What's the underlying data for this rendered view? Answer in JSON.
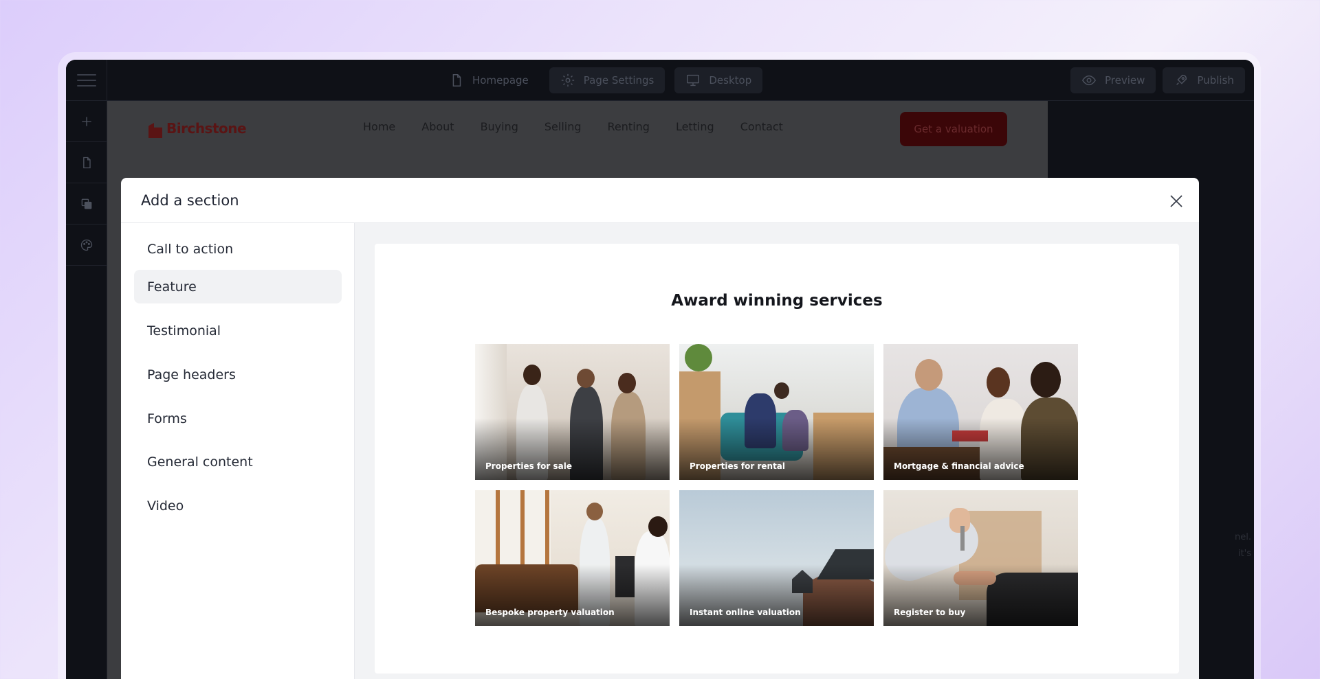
{
  "topbar": {
    "page_label": "Homepage",
    "settings_label": "Page Settings",
    "device_label": "Desktop",
    "preview_label": "Preview",
    "publish_label": "Publish"
  },
  "site": {
    "logo_text": "Birchstone",
    "nav": [
      "Home",
      "About",
      "Buying",
      "Selling",
      "Renting",
      "Letting",
      "Contact"
    ],
    "cta_label": "Get a valuation"
  },
  "right_panel": {
    "hint_lines": [
      "nel.",
      "it's"
    ]
  },
  "modal": {
    "title": "Add a section",
    "categories": [
      "Call to action",
      "Feature",
      "Testimonial",
      "Page headers",
      "Forms",
      "General content",
      "Video"
    ],
    "active_category": "Feature",
    "preview": {
      "heading": "Award winning services",
      "tiles": [
        "Properties for sale",
        "Properties for rental",
        "Mortgage & financial advice",
        "Bespoke property valuation",
        "Instant online valuation",
        "Register to buy"
      ]
    }
  },
  "colors": {
    "brand": "#c8161d",
    "app_bg": "#0f1117"
  },
  "icons": [
    "menu-icon",
    "file-icon",
    "gear-icon",
    "monitor-icon",
    "eye-icon",
    "rocket-icon",
    "plus-icon",
    "layers-icon",
    "palette-icon",
    "close-icon"
  ]
}
